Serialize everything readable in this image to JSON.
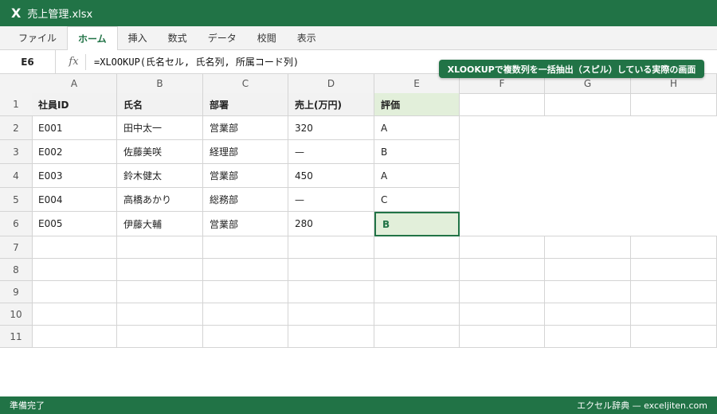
{
  "app": {
    "icon": "X",
    "filename": "売上管理.xlsx"
  },
  "ribbon": {
    "tabs": [
      "ファイル",
      "ホーム",
      "挿入",
      "数式",
      "データ",
      "校閲",
      "表示"
    ],
    "active_tab": "ホーム"
  },
  "formula_bar": {
    "name_box": "E6",
    "fx_label": "fx",
    "formula": "=XLOOKUP(氏名セル, 氏名列, 所属コード列)"
  },
  "callout": "XLOOKUPで複数列を一括抽出（スピル）している実際の画面",
  "sheet": {
    "columns": [
      "A",
      "B",
      "C",
      "D",
      "E",
      "F",
      "G",
      "H"
    ],
    "row_numbers": [
      "1",
      "2",
      "3",
      "4",
      "5",
      "6",
      "7",
      "8",
      "9",
      "10",
      "11"
    ],
    "header": [
      "社員ID",
      "氏名",
      "部署",
      "売上(万円)",
      "評価"
    ],
    "rows": [
      [
        "E001",
        "田中太一",
        "営業部",
        "320",
        "A"
      ],
      [
        "E002",
        "佐藤美咲",
        "経理部",
        "—",
        "B"
      ],
      [
        "E003",
        "鈴木健太",
        "営業部",
        "450",
        "A"
      ],
      [
        "E004",
        "高橋あかり",
        "総務部",
        "—",
        "C"
      ],
      [
        "E005",
        "伊藤大輔",
        "営業部",
        "280",
        "B"
      ]
    ],
    "selected_cell": "E6"
  },
  "status": {
    "left": "準備完了",
    "right": "エクセル辞典 — exceljiten.com"
  },
  "colors": {
    "accent": "#217346",
    "selected_fill": "#e2efda",
    "header_fill": "#f3f3f3"
  }
}
